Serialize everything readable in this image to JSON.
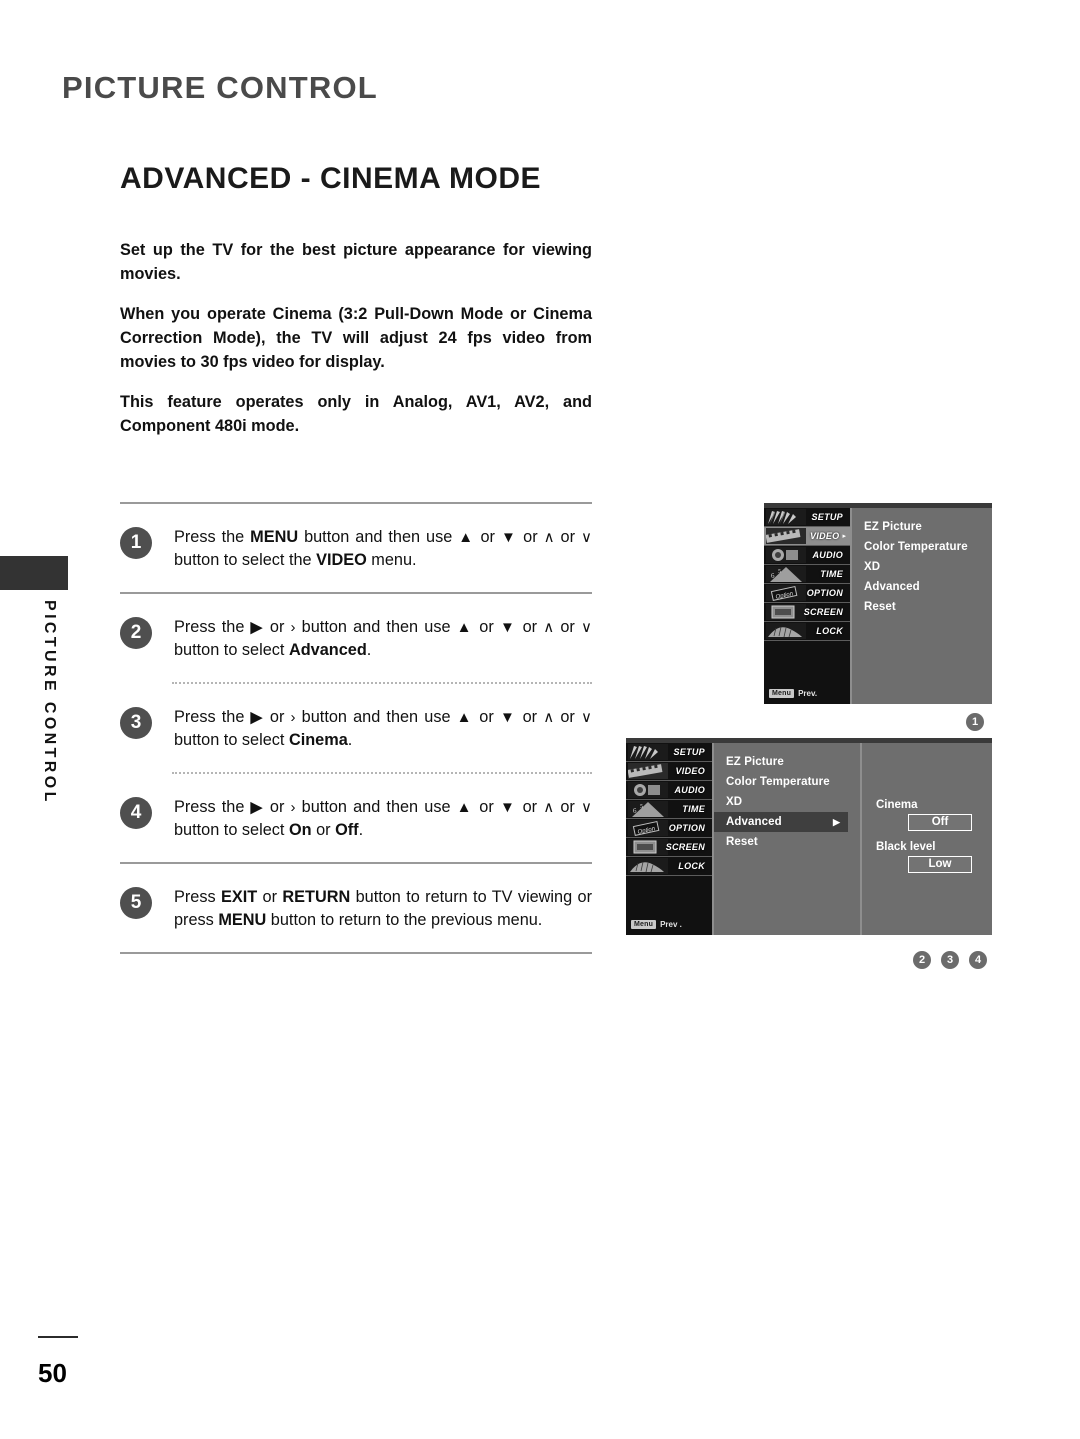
{
  "running_head": "PICTURE CONTROL",
  "section_title": "ADVANCED - CINEMA MODE",
  "vertical_tab_label": "PICTURE CONTROL",
  "intro": {
    "p1": "Set up the TV for the best picture appearance for viewing movies.",
    "p2": "When you operate Cinema (3:2 Pull-Down Mode or Cinema Correction Mode), the TV will adjust 24 fps video from movies to 30 fps video for display.",
    "p3": "This feature operates only in Analog, AV1, AV2, and Component 480i mode."
  },
  "steps": [
    {
      "number": "1",
      "parts": {
        "a": "Press the ",
        "b": "MENU",
        "c": " button and then use ",
        "up": "▲",
        "or1": " or ",
        "down": "▼",
        "or2": " or ",
        "caret_up": "∧",
        "or3": " or ",
        "caret_down": "∨",
        "d": " button to select the ",
        "e": "VIDEO",
        "f": " menu."
      }
    },
    {
      "number": "2",
      "parts": {
        "a": "Press the ",
        "b": "▶",
        "c": " or ",
        "d": "›",
        "e": " button and then use ",
        "up": "▲",
        "or1": " or ",
        "down": "▼",
        "or2": " or ",
        "caret_up": "∧",
        "or3": " or ",
        "caret_down": "∨",
        "f": " button to select ",
        "g": "Advanced",
        "h": "."
      }
    },
    {
      "number": "3",
      "parts": {
        "a": "Press the ",
        "b": "▶",
        "c": " or ",
        "d": "›",
        "e": " button and then use ",
        "up": "▲",
        "or1": " or ",
        "down": "▼",
        "or2": " or ",
        "caret_up": "∧",
        "or3": " or ",
        "caret_down": "∨",
        "f": " button to select ",
        "g": "Cinema",
        "h": "."
      }
    },
    {
      "number": "4",
      "parts": {
        "a": "Press the ",
        "b": "▶",
        "c": " or ",
        "d": "›",
        "e": " button and then use ",
        "up": "▲",
        "or1": " or ",
        "down": "▼",
        "or2": " or ",
        "caret_up": "∧",
        "or3": " or ",
        "caret_down": "∨",
        "f": " button to select ",
        "g": "On",
        "h": " or ",
        "i": "Off",
        "j": "."
      }
    },
    {
      "number": "5",
      "parts": {
        "a": "Press ",
        "b": "EXIT",
        "c": " or ",
        "d": "RETURN",
        "e": " button to return to TV viewing or press ",
        "f": "MENU",
        "g": " button to return to the previous menu."
      }
    }
  ],
  "osd1": {
    "sidebar": [
      {
        "label": "SETUP",
        "active": false,
        "arrow": "",
        "icon": "fan-icon"
      },
      {
        "label": "VIDEO",
        "active": true,
        "arrow": "▸",
        "icon": "film-strip-icon"
      },
      {
        "label": "AUDIO",
        "active": false,
        "arrow": "",
        "icon": "speaker-icon"
      },
      {
        "label": "TIME",
        "active": false,
        "arrow": "",
        "icon": "clock-icon"
      },
      {
        "label": "OPTION",
        "active": false,
        "arrow": "",
        "icon": "tag-icon"
      },
      {
        "label": "SCREEN",
        "active": false,
        "arrow": "",
        "icon": "monitor-icon"
      },
      {
        "label": "LOCK",
        "active": false,
        "arrow": "",
        "icon": "accordion-icon"
      }
    ],
    "prev_pill": "Menu",
    "prev_text": "Prev.",
    "items": [
      {
        "label": "EZ Picture",
        "highlight": false,
        "arrow": ""
      },
      {
        "label": "Color Temperature",
        "highlight": false,
        "arrow": ""
      },
      {
        "label": "XD",
        "highlight": false,
        "arrow": ""
      },
      {
        "label": "Advanced",
        "highlight": false,
        "arrow": ""
      },
      {
        "label": "Reset",
        "highlight": false,
        "arrow": ""
      }
    ],
    "marker": "1"
  },
  "osd2": {
    "sidebar": [
      {
        "label": "SETUP",
        "active": false,
        "arrow": "",
        "icon": "fan-icon"
      },
      {
        "label": "VIDEO",
        "active": false,
        "arrow": "",
        "icon": "film-strip-icon"
      },
      {
        "label": "AUDIO",
        "active": false,
        "arrow": "",
        "icon": "speaker-icon"
      },
      {
        "label": "TIME",
        "active": false,
        "arrow": "",
        "icon": "clock-icon"
      },
      {
        "label": "OPTION",
        "active": false,
        "arrow": "",
        "icon": "tag-icon"
      },
      {
        "label": "SCREEN",
        "active": false,
        "arrow": "",
        "icon": "monitor-icon"
      },
      {
        "label": "LOCK",
        "active": false,
        "arrow": "",
        "icon": "accordion-icon"
      }
    ],
    "prev_pill": "Menu",
    "prev_text": "Prev .",
    "items": [
      {
        "label": "EZ Picture",
        "highlight": false,
        "arrow": ""
      },
      {
        "label": "Color Temperature",
        "highlight": false,
        "arrow": ""
      },
      {
        "label": "XD",
        "highlight": false,
        "arrow": ""
      },
      {
        "label": "Advanced",
        "highlight": true,
        "arrow": "▶"
      },
      {
        "label": "Reset",
        "highlight": false,
        "arrow": ""
      }
    ],
    "fields": [
      {
        "label": "Cinema",
        "value": "Off"
      },
      {
        "label": "Black level",
        "value": "Low"
      }
    ],
    "markers": [
      "2",
      "3",
      "4"
    ]
  },
  "page_number": "50",
  "colors": {
    "osd_panel": "#6e6e6e",
    "osd_sidebar": "#111111",
    "osd_highlight": "#3f3f3f",
    "marker": "#6b6b6b",
    "running_head": "#4a4a4a"
  }
}
